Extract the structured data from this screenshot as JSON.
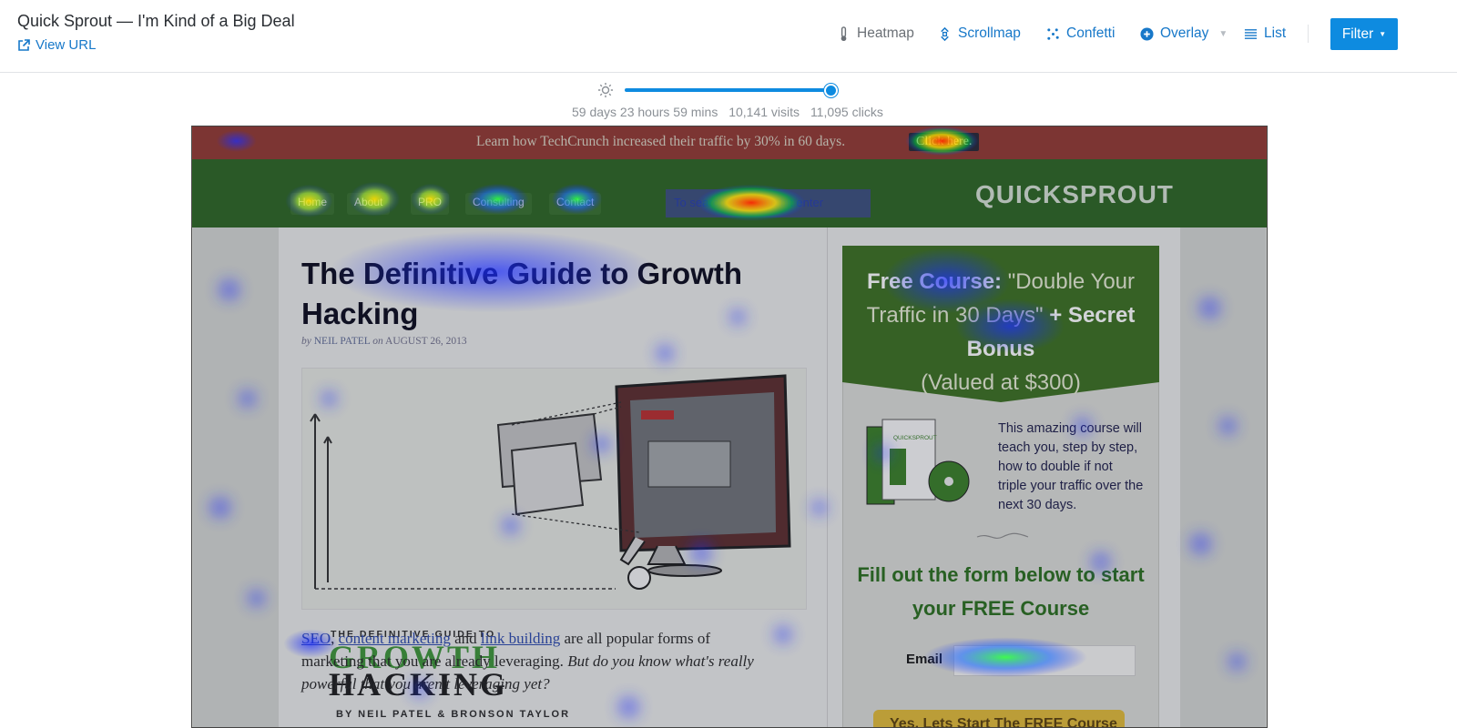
{
  "header": {
    "title": "Quick Sprout — I'm Kind of a Big Deal",
    "view_url": "View URL"
  },
  "nav": {
    "heatmap": "Heatmap",
    "scrollmap": "Scrollmap",
    "confetti": "Confetti",
    "overlay": "Overlay",
    "list": "List",
    "filter": "Filter"
  },
  "stats": {
    "duration": "59 days 23 hours 59 mins",
    "visits": "10,141 visits",
    "clicks": "11,095 clicks",
    "brightness_level": 1.0
  },
  "page": {
    "banner_text": "Learn how TechCrunch increased their traffic by 30% in 60 days.",
    "banner_button": "Click here.",
    "site_nav": [
      "Home",
      "About",
      "PRO",
      "Consulting",
      "Contact"
    ],
    "search_placeholder": "To search, type and hit enter",
    "logo": "QUICKSPROUT",
    "post_title": "The Definitive Guide to Growth Hacking",
    "byline_prefix": "by",
    "byline_author": "NEIL PATEL",
    "byline_on": "on",
    "byline_date": "AUGUST 26, 2013",
    "image_kicker": "THE DEFINITIVE GUIDE TO",
    "image_title_1": "GROWTH",
    "image_title_2": "HACKING",
    "image_credit": "BY NEIL PATEL & BRONSON TAYLOR",
    "body": {
      "link1": "SEO",
      "sep1": ", ",
      "link2": "content marketing",
      "and": " and ",
      "link3": "link building",
      "rest": " are all popular forms of marketing that you are already leveraging. ",
      "italic": "But do you know what's really powerful that you aren't leveraging yet?"
    },
    "promo_label": "Free Course:",
    "promo_quote": "\"Double Your Traffic in 30 Days\"",
    "promo_plus": "+ Secret Bonus",
    "promo_value": "(Valued at $300)",
    "course_logo": "QUICKSPROUT",
    "course_text": "This amazing course will teach you, step by step, how to double if not triple your traffic over the next 30 days.",
    "form_title": "Fill out the form below to start your FREE Course",
    "email_label": "Email",
    "cta": "Yes, Lets Start The FREE Course"
  },
  "colors": {
    "accent": "#0e8be0",
    "link": "#1778c9",
    "heat_hot": "#ff2a00",
    "heat_warm": "#ffe000",
    "heat_cool": "#1a2cff"
  }
}
